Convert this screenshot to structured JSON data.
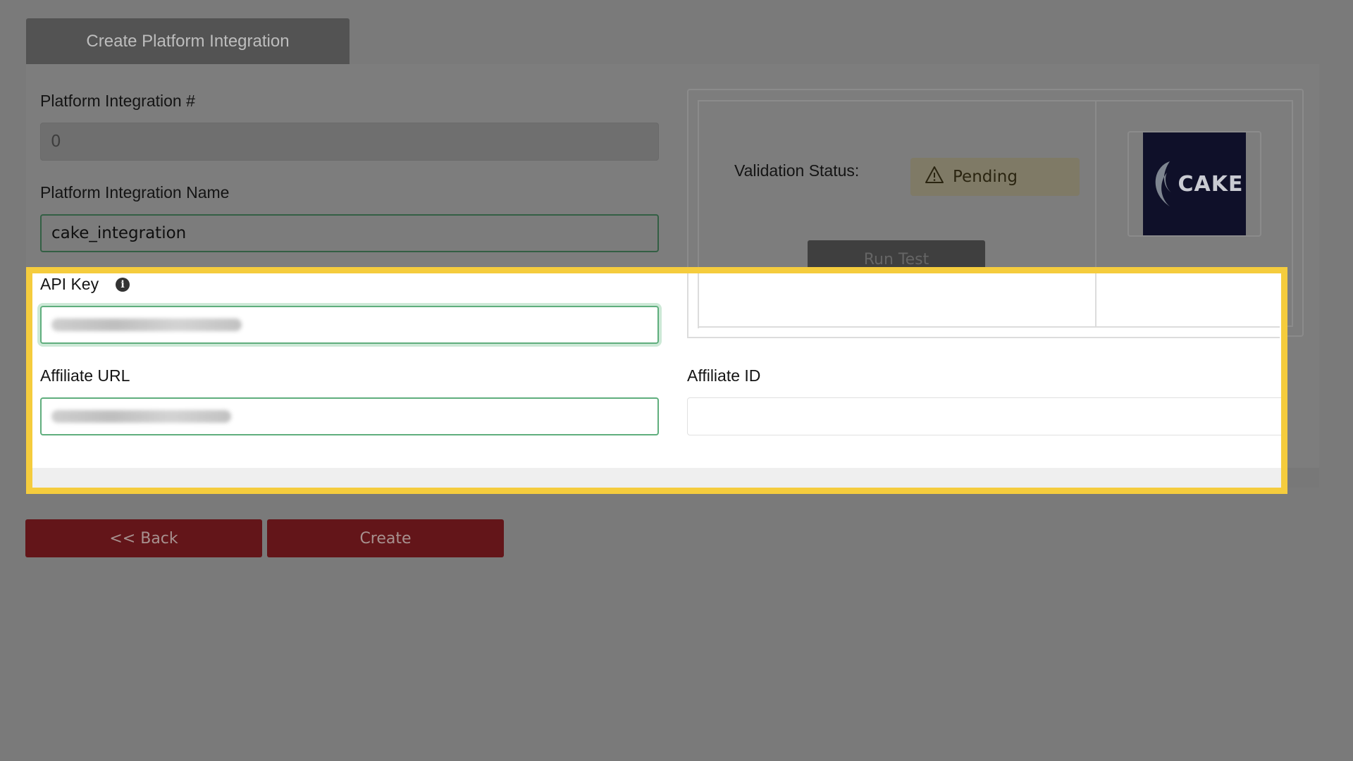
{
  "tab": {
    "title": "Create Platform Integration"
  },
  "form": {
    "integration_number": {
      "label": "Platform Integration #",
      "value": "0"
    },
    "integration_name": {
      "label": "Platform Integration Name",
      "value": "cake_integration"
    },
    "api_key": {
      "label": "API Key",
      "value": ""
    },
    "affiliate_url": {
      "label": "Affiliate URL",
      "value": ""
    },
    "affiliate_id": {
      "label": "Affiliate ID",
      "value": ""
    }
  },
  "validation": {
    "label": "Validation Status:",
    "status": "Pending",
    "status_icon": "warning-icon",
    "run_test_label": "Run Test"
  },
  "logo": {
    "text": "CAKE",
    "icon": "cake-logo-icon"
  },
  "actions": {
    "back_label": "<< Back",
    "create_label": "Create"
  },
  "colors": {
    "highlight": "#f5cc3d",
    "button": "#631519",
    "focus_border": "#5fae7d",
    "pending_badge": "#fbf0c6"
  }
}
